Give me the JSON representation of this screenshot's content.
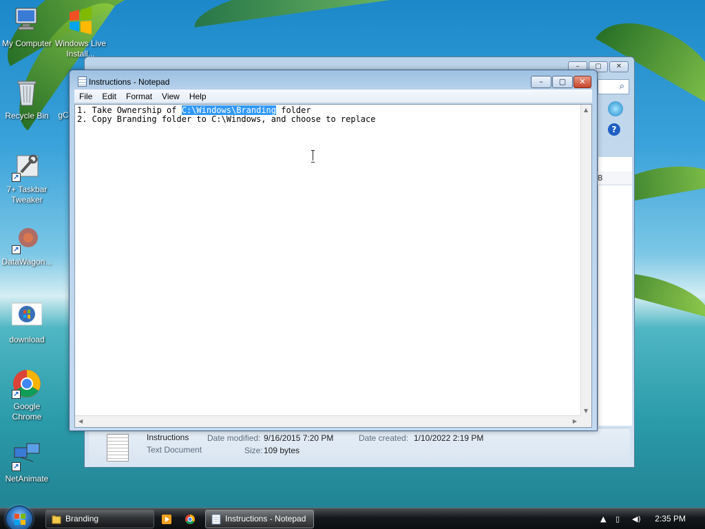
{
  "desktop": {
    "icons": [
      {
        "label": "My Computer"
      },
      {
        "label": "Windows Live Install..."
      },
      {
        "label": "Recycle Bin"
      },
      {
        "label": "gC"
      },
      {
        "label": "7+ Taskbar Tweaker"
      },
      {
        "label": "DataWagon..."
      },
      {
        "label": "download"
      },
      {
        "label": "Google Chrome"
      },
      {
        "label": "NetAnimate"
      }
    ]
  },
  "explorer": {
    "column_header_fragment": "B",
    "details": {
      "file_name": "Instructions",
      "file_type": "Text Document",
      "date_modified_label": "Date modified:",
      "date_modified": "9/16/2015 7:20 PM",
      "date_created_label": "Date created:",
      "date_created": "1/10/2022 2:19 PM",
      "size_label": "Size:",
      "size": "109 bytes"
    }
  },
  "notepad": {
    "title": "Instructions - Notepad",
    "menu": [
      "File",
      "Edit",
      "Format",
      "View",
      "Help"
    ],
    "line1_prefix": "1. Take Ownership of ",
    "line1_selected": "C:\\Windows\\Branding",
    "line1_suffix": " folder",
    "line2": "2. Copy Branding folder to C:\\Windows, and choose to replace"
  },
  "taskbar": {
    "items": [
      {
        "label": "Branding",
        "active": false
      },
      {
        "label": "Instructions - Notepad",
        "active": true
      }
    ],
    "clock": "2:35 PM"
  }
}
